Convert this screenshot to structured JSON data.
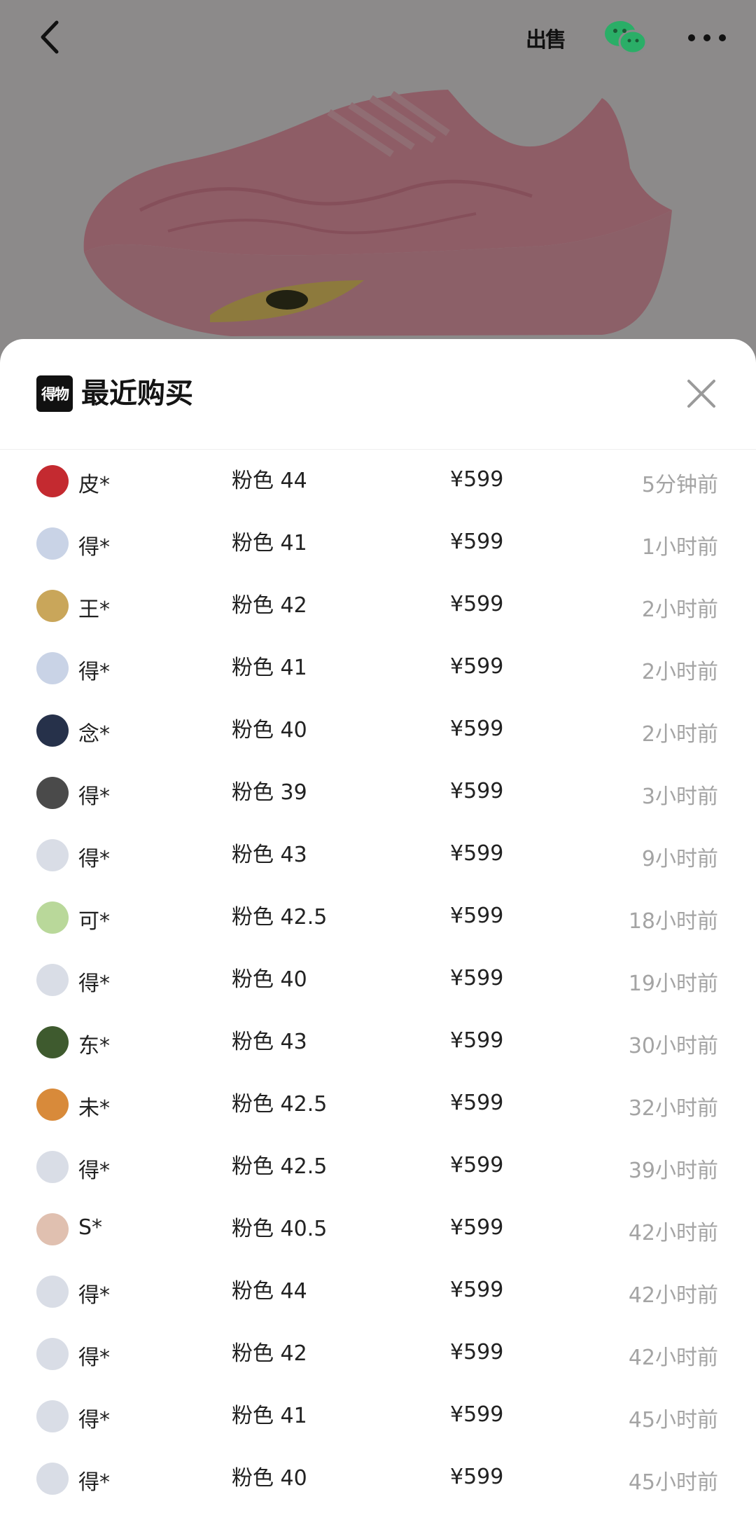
{
  "header": {
    "sell_label": "出售"
  },
  "sheet": {
    "logo_text": "得物",
    "title": "最近购买"
  },
  "purchases": [
    {
      "name": "皮*",
      "spec": "粉色 44",
      "price": "¥599",
      "time": "5分钟前",
      "avatar": "#c42a30"
    },
    {
      "name": "得*",
      "spec": "粉色 41",
      "price": "¥599",
      "time": "1小时前",
      "avatar": "#c9d3e6"
    },
    {
      "name": "王*",
      "spec": "粉色 42",
      "price": "¥599",
      "time": "2小时前",
      "avatar": "#c9a65a"
    },
    {
      "name": "得*",
      "spec": "粉色 41",
      "price": "¥599",
      "time": "2小时前",
      "avatar": "#c9d3e6"
    },
    {
      "name": "念*",
      "spec": "粉色 40",
      "price": "¥599",
      "time": "2小时前",
      "avatar": "#26314a"
    },
    {
      "name": "得*",
      "spec": "粉色 39",
      "price": "¥599",
      "time": "3小时前",
      "avatar": "#4a4a4a"
    },
    {
      "name": "得*",
      "spec": "粉色 43",
      "price": "¥599",
      "time": "9小时前",
      "avatar": "#d9dde6"
    },
    {
      "name": "可*",
      "spec": "粉色 42.5",
      "price": "¥599",
      "time": "18小时前",
      "avatar": "#b9d89a"
    },
    {
      "name": "得*",
      "spec": "粉色 40",
      "price": "¥599",
      "time": "19小时前",
      "avatar": "#d9dde6"
    },
    {
      "name": "东*",
      "spec": "粉色 43",
      "price": "¥599",
      "time": "30小时前",
      "avatar": "#3e5a2e"
    },
    {
      "name": "未*",
      "spec": "粉色 42.5",
      "price": "¥599",
      "time": "32小时前",
      "avatar": "#d88a3a"
    },
    {
      "name": "得*",
      "spec": "粉色 42.5",
      "price": "¥599",
      "time": "39小时前",
      "avatar": "#d9dde6"
    },
    {
      "name": "S*",
      "spec": "粉色 40.5",
      "price": "¥599",
      "time": "42小时前",
      "avatar": "#e0c0b0"
    },
    {
      "name": "得*",
      "spec": "粉色 44",
      "price": "¥599",
      "time": "42小时前",
      "avatar": "#d9dde6"
    },
    {
      "name": "得*",
      "spec": "粉色 42",
      "price": "¥599",
      "time": "42小时前",
      "avatar": "#d9dde6"
    },
    {
      "name": "得*",
      "spec": "粉色 41",
      "price": "¥599",
      "time": "45小时前",
      "avatar": "#d9dde6"
    },
    {
      "name": "得*",
      "spec": "粉色 40",
      "price": "¥599",
      "time": "45小时前",
      "avatar": "#d9dde6"
    }
  ]
}
